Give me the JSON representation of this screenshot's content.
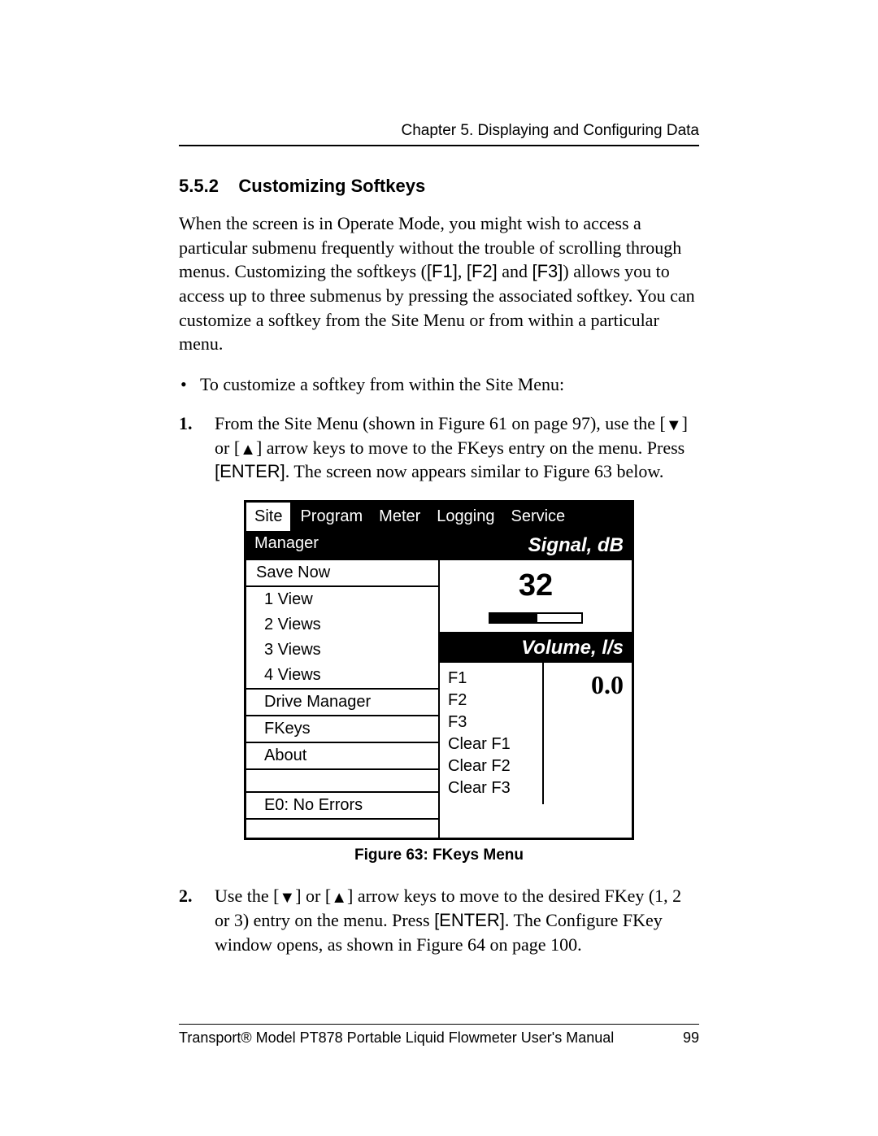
{
  "chapter_line": "Chapter 5. Displaying and Configuring Data",
  "section": {
    "number": "5.5.2",
    "title": "Customizing Softkeys"
  },
  "intro_para": {
    "t1": "When the screen is in Operate Mode, you might wish to access a particular submenu frequently without the trouble of scrolling through menus. Customizing the softkeys (",
    "k1": "[F1]",
    "t2": ", ",
    "k2": "[F2]",
    "t3": " and ",
    "k3": "[F3]",
    "t4": ") allows you to access up to three submenus by pressing the associated softkey. You can customize a softkey from the Site Menu or from within a particular menu."
  },
  "bullet1": "To customize a softkey from within the Site Menu:",
  "step1": {
    "num": "1.",
    "t1": "From the Site Menu (shown in Figure 61 on page 97), use the [",
    "down": "▼",
    "t2": "] or [",
    "up": "▲",
    "t3": "] arrow keys to move to the FKeys entry on the menu. Press ",
    "enter": "[ENTER]",
    "t4": ". The screen now appears similar to Figure 63 below."
  },
  "figure": {
    "tabs": [
      "Site",
      "Program",
      "Meter",
      "Logging",
      "Service"
    ],
    "left_header": "Manager",
    "right_header": "Signal, dB",
    "menu": {
      "save_now": "Save Now",
      "views": [
        "1 View",
        "2 Views",
        "3 Views",
        "4 Views"
      ],
      "drive_manager": "Drive Manager",
      "fkeys": "FKeys",
      "about": "About",
      "status": "E0: No Errors"
    },
    "signal_value": "32",
    "volume_header": "Volume, l/s",
    "fkey_list": [
      "F1",
      "F2",
      "F3",
      "Clear F1",
      "Clear F2",
      "Clear F3"
    ],
    "volume_value": "0.0",
    "caption": "Figure 63: FKeys Menu"
  },
  "step2": {
    "num": "2.",
    "t1": "Use the [",
    "down": "▼",
    "t2": "] or [",
    "up": "▲",
    "t3": "] arrow keys to move to the desired FKey (1, 2 or 3) entry on the menu. Press ",
    "enter": "[ENTER]",
    "t4": ". The Configure FKey window opens, as shown in Figure 64 on page 100."
  },
  "footer": {
    "left": "Transport® Model PT878 Portable Liquid Flowmeter User's Manual",
    "right": "99"
  }
}
